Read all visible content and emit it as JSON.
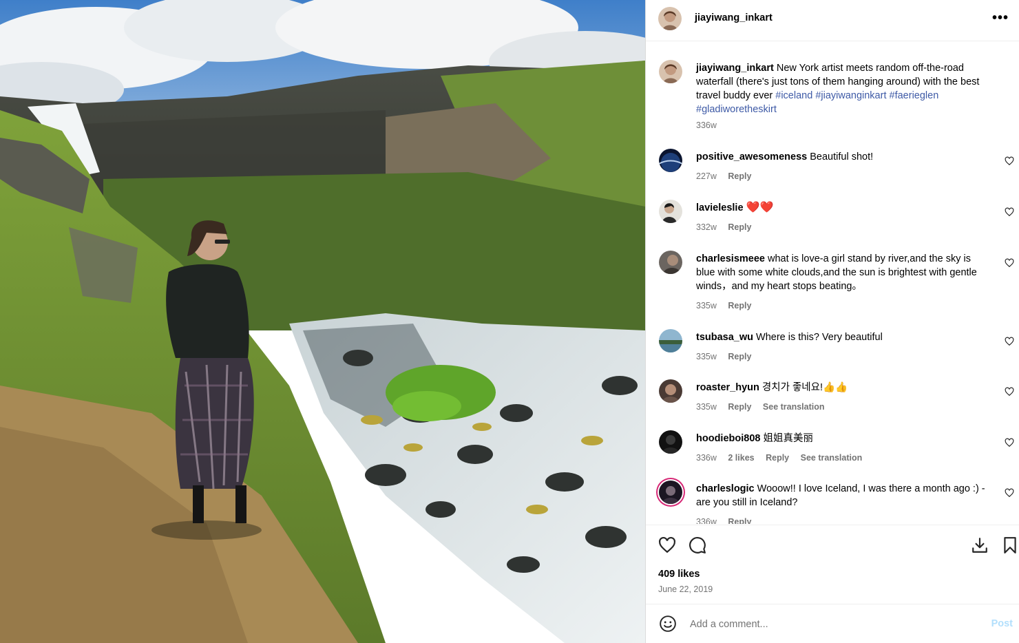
{
  "post": {
    "username": "jiayiwang_inkart",
    "caption_text": "New York artist meets random off-the-road waterfall (there's just tons of them hanging around) with the best travel buddy ever",
    "hashtags": [
      "#iceland",
      "#jiayiwanginkart",
      "#faerieglen",
      "#gladiworetheskirt"
    ],
    "caption_time": "336w",
    "likes": "409 likes",
    "date": "June 22, 2019"
  },
  "comments": [
    {
      "username": "positive_awesomeness",
      "text": "Beautiful shot!",
      "time": "227w",
      "reply": "Reply"
    },
    {
      "username": "lavieleslie",
      "text": "❤️❤️",
      "time": "332w",
      "reply": "Reply"
    },
    {
      "username": "charlesismeee",
      "text": "what is love-a girl stand by river,and the sky is blue with some white clouds,and the sun is brightest with gentle winds，and my heart stops beating。",
      "time": "335w",
      "reply": "Reply"
    },
    {
      "username": "tsubasa_wu",
      "text": "Where is this? Very beautiful",
      "time": "335w",
      "reply": "Reply"
    },
    {
      "username": "roaster_hyun",
      "text": "경치가 좋네요!👍👍",
      "time": "335w",
      "reply": "Reply",
      "see_translation": "See translation"
    },
    {
      "username": "hoodieboi808",
      "text": "姐姐真美丽",
      "time": "336w",
      "likes": "2 likes",
      "reply": "Reply",
      "see_translation": "See translation"
    },
    {
      "username": "charleslogic",
      "text": "Wooow!! I love Iceland, I was there a month ago :) - are you still in Iceland?",
      "time": "336w",
      "reply": "Reply"
    }
  ],
  "composer": {
    "placeholder": "Add a comment...",
    "post_label": "Post"
  },
  "icons": {
    "more": "more-options-icon",
    "like": "heart-icon",
    "comment": "comment-icon",
    "download": "download-icon",
    "save": "bookmark-icon",
    "emoji": "emoji-icon"
  },
  "colors": {
    "hashtag": "#3e5aa6",
    "muted": "#737373",
    "post_button_disabled": "#b2dffc"
  }
}
